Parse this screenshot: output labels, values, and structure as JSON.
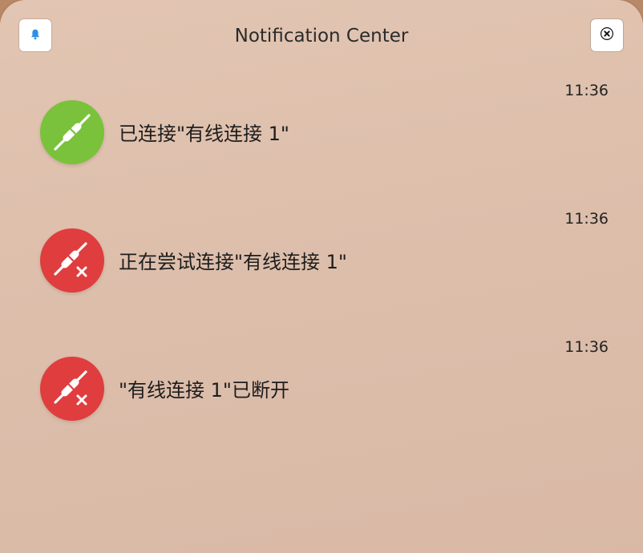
{
  "header": {
    "title": "Notification Center",
    "bell_icon": "bell-icon",
    "close_icon": "close-icon"
  },
  "notifications": [
    {
      "time": "11:36",
      "message": "已连接\"有线连接 1\"",
      "status": "connected",
      "icon": "ethernet-connected-icon",
      "color": "#7ac23c"
    },
    {
      "time": "11:36",
      "message": "正在尝试连接\"有线连接 1\"",
      "status": "error",
      "icon": "ethernet-disconnected-icon",
      "color": "#e03d3f"
    },
    {
      "time": "11:36",
      "message": "\"有线连接 1\"已断开",
      "status": "error",
      "icon": "ethernet-disconnected-icon",
      "color": "#e03d3f"
    }
  ]
}
